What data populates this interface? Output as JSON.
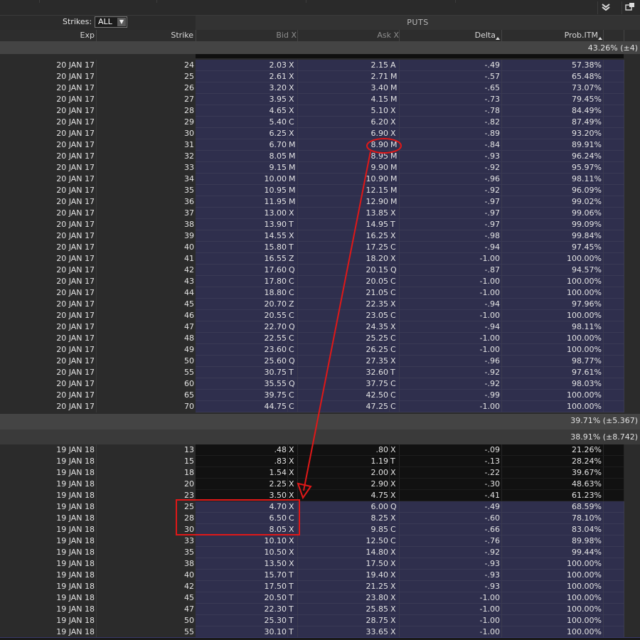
{
  "toolbar": {
    "collapse_icon": "chevron-down-icon",
    "popout_icon": "popout-icon"
  },
  "controls": {
    "strikes_label": "Strikes:",
    "strikes_value": "ALL"
  },
  "header": {
    "section": "PUTS",
    "columns": {
      "exp": "Exp",
      "strike": "Strike",
      "bid": "Bid X",
      "ask": "Ask X",
      "delta": "Delta",
      "prob": "Prob.ITM"
    }
  },
  "bands": {
    "jan17_top": "43.26% (±4)",
    "jan17_bottom": "39.71% (±5.367)",
    "jan18_top": "38.91% (±8.742)"
  },
  "jan17_rows": [
    {
      "exp": "20 JAN 17",
      "strike": "24",
      "bid": "2.03",
      "bx": "X",
      "ask": "2.15",
      "ax": "A",
      "delta": "-.49",
      "prob": "57.38%"
    },
    {
      "exp": "20 JAN 17",
      "strike": "25",
      "bid": "2.61",
      "bx": "X",
      "ask": "2.71",
      "ax": "M",
      "delta": "-.57",
      "prob": "65.48%"
    },
    {
      "exp": "20 JAN 17",
      "strike": "26",
      "bid": "3.20",
      "bx": "X",
      "ask": "3.40",
      "ax": "M",
      "delta": "-.65",
      "prob": "73.07%"
    },
    {
      "exp": "20 JAN 17",
      "strike": "27",
      "bid": "3.95",
      "bx": "X",
      "ask": "4.15",
      "ax": "M",
      "delta": "-.73",
      "prob": "79.45%"
    },
    {
      "exp": "20 JAN 17",
      "strike": "28",
      "bid": "4.65",
      "bx": "X",
      "ask": "5.10",
      "ax": "X",
      "delta": "-.78",
      "prob": "84.49%"
    },
    {
      "exp": "20 JAN 17",
      "strike": "29",
      "bid": "5.40",
      "bx": "C",
      "ask": "6.20",
      "ax": "X",
      "delta": "-.82",
      "prob": "87.49%"
    },
    {
      "exp": "20 JAN 17",
      "strike": "30",
      "bid": "6.25",
      "bx": "X",
      "ask": "6.90",
      "ax": "X",
      "delta": "-.89",
      "prob": "93.20%"
    },
    {
      "exp": "20 JAN 17",
      "strike": "31",
      "bid": "6.70",
      "bx": "M",
      "ask": "8.90",
      "ax": "M",
      "delta": "-.84",
      "prob": "89.91%"
    },
    {
      "exp": "20 JAN 17",
      "strike": "32",
      "bid": "8.05",
      "bx": "M",
      "ask": "8.95",
      "ax": "M",
      "delta": "-.93",
      "prob": "96.24%"
    },
    {
      "exp": "20 JAN 17",
      "strike": "33",
      "bid": "9.15",
      "bx": "M",
      "ask": "9.90",
      "ax": "M",
      "delta": "-.92",
      "prob": "95.97%"
    },
    {
      "exp": "20 JAN 17",
      "strike": "34",
      "bid": "10.00",
      "bx": "M",
      "ask": "10.90",
      "ax": "M",
      "delta": "-.96",
      "prob": "98.11%"
    },
    {
      "exp": "20 JAN 17",
      "strike": "35",
      "bid": "10.95",
      "bx": "M",
      "ask": "12.15",
      "ax": "M",
      "delta": "-.92",
      "prob": "96.09%"
    },
    {
      "exp": "20 JAN 17",
      "strike": "36",
      "bid": "11.95",
      "bx": "M",
      "ask": "12.90",
      "ax": "M",
      "delta": "-.97",
      "prob": "99.02%"
    },
    {
      "exp": "20 JAN 17",
      "strike": "37",
      "bid": "13.00",
      "bx": "X",
      "ask": "13.85",
      "ax": "X",
      "delta": "-.97",
      "prob": "99.06%"
    },
    {
      "exp": "20 JAN 17",
      "strike": "38",
      "bid": "13.90",
      "bx": "T",
      "ask": "14.95",
      "ax": "T",
      "delta": "-.97",
      "prob": "99.09%"
    },
    {
      "exp": "20 JAN 17",
      "strike": "39",
      "bid": "14.55",
      "bx": "X",
      "ask": "16.25",
      "ax": "X",
      "delta": "-.98",
      "prob": "99.84%"
    },
    {
      "exp": "20 JAN 17",
      "strike": "40",
      "bid": "15.80",
      "bx": "T",
      "ask": "17.25",
      "ax": "C",
      "delta": "-.94",
      "prob": "97.45%"
    },
    {
      "exp": "20 JAN 17",
      "strike": "41",
      "bid": "16.55",
      "bx": "Z",
      "ask": "18.20",
      "ax": "X",
      "delta": "-1.00",
      "prob": "100.00%"
    },
    {
      "exp": "20 JAN 17",
      "strike": "42",
      "bid": "17.60",
      "bx": "Q",
      "ask": "20.15",
      "ax": "Q",
      "delta": "-.87",
      "prob": "94.57%"
    },
    {
      "exp": "20 JAN 17",
      "strike": "43",
      "bid": "17.80",
      "bx": "C",
      "ask": "20.05",
      "ax": "C",
      "delta": "-1.00",
      "prob": "100.00%"
    },
    {
      "exp": "20 JAN 17",
      "strike": "44",
      "bid": "18.80",
      "bx": "C",
      "ask": "21.05",
      "ax": "C",
      "delta": "-1.00",
      "prob": "100.00%"
    },
    {
      "exp": "20 JAN 17",
      "strike": "45",
      "bid": "20.70",
      "bx": "Z",
      "ask": "22.35",
      "ax": "X",
      "delta": "-.94",
      "prob": "97.96%"
    },
    {
      "exp": "20 JAN 17",
      "strike": "46",
      "bid": "20.55",
      "bx": "C",
      "ask": "23.05",
      "ax": "C",
      "delta": "-1.00",
      "prob": "100.00%"
    },
    {
      "exp": "20 JAN 17",
      "strike": "47",
      "bid": "22.70",
      "bx": "Q",
      "ask": "24.35",
      "ax": "X",
      "delta": "-.94",
      "prob": "98.11%"
    },
    {
      "exp": "20 JAN 17",
      "strike": "48",
      "bid": "22.55",
      "bx": "C",
      "ask": "25.25",
      "ax": "C",
      "delta": "-1.00",
      "prob": "100.00%"
    },
    {
      "exp": "20 JAN 17",
      "strike": "49",
      "bid": "23.60",
      "bx": "C",
      "ask": "26.25",
      "ax": "C",
      "delta": "-1.00",
      "prob": "100.00%"
    },
    {
      "exp": "20 JAN 17",
      "strike": "50",
      "bid": "25.60",
      "bx": "Q",
      "ask": "27.35",
      "ax": "X",
      "delta": "-.96",
      "prob": "98.77%"
    },
    {
      "exp": "20 JAN 17",
      "strike": "55",
      "bid": "30.75",
      "bx": "T",
      "ask": "32.60",
      "ax": "T",
      "delta": "-.92",
      "prob": "97.61%"
    },
    {
      "exp": "20 JAN 17",
      "strike": "60",
      "bid": "35.55",
      "bx": "Q",
      "ask": "37.75",
      "ax": "C",
      "delta": "-.92",
      "prob": "98.03%"
    },
    {
      "exp": "20 JAN 17",
      "strike": "65",
      "bid": "39.75",
      "bx": "C",
      "ask": "42.50",
      "ax": "C",
      "delta": "-.99",
      "prob": "100.00%"
    },
    {
      "exp": "20 JAN 17",
      "strike": "70",
      "bid": "44.75",
      "bx": "C",
      "ask": "47.25",
      "ax": "C",
      "delta": "-1.00",
      "prob": "100.00%"
    }
  ],
  "jan18_rows": [
    {
      "exp": "19 JAN 18",
      "strike": "13",
      "bid": ".48",
      "bx": "X",
      "ask": ".80",
      "ax": "X",
      "delta": "-.09",
      "prob": "21.26%",
      "itm": false
    },
    {
      "exp": "19 JAN 18",
      "strike": "15",
      "bid": ".83",
      "bx": "X",
      "ask": "1.19",
      "ax": "T",
      "delta": "-.13",
      "prob": "28.24%",
      "itm": false
    },
    {
      "exp": "19 JAN 18",
      "strike": "18",
      "bid": "1.54",
      "bx": "X",
      "ask": "2.00",
      "ax": "X",
      "delta": "-.22",
      "prob": "39.67%",
      "itm": false
    },
    {
      "exp": "19 JAN 18",
      "strike": "20",
      "bid": "2.25",
      "bx": "X",
      "ask": "2.90",
      "ax": "X",
      "delta": "-.30",
      "prob": "48.63%",
      "itm": false
    },
    {
      "exp": "19 JAN 18",
      "strike": "23",
      "bid": "3.50",
      "bx": "X",
      "ask": "4.75",
      "ax": "X",
      "delta": "-.41",
      "prob": "61.23%",
      "itm": false
    },
    {
      "exp": "19 JAN 18",
      "strike": "25",
      "bid": "4.70",
      "bx": "X",
      "ask": "6.00",
      "ax": "Q",
      "delta": "-.49",
      "prob": "68.59%",
      "itm": true
    },
    {
      "exp": "19 JAN 18",
      "strike": "28",
      "bid": "6.50",
      "bx": "C",
      "ask": "8.25",
      "ax": "X",
      "delta": "-.60",
      "prob": "78.10%",
      "itm": true
    },
    {
      "exp": "19 JAN 18",
      "strike": "30",
      "bid": "8.05",
      "bx": "X",
      "ask": "9.85",
      "ax": "C",
      "delta": "-.66",
      "prob": "83.04%",
      "itm": true
    },
    {
      "exp": "19 JAN 18",
      "strike": "33",
      "bid": "10.10",
      "bx": "X",
      "ask": "12.50",
      "ax": "C",
      "delta": "-.76",
      "prob": "89.98%",
      "itm": true
    },
    {
      "exp": "19 JAN 18",
      "strike": "35",
      "bid": "10.50",
      "bx": "X",
      "ask": "14.80",
      "ax": "X",
      "delta": "-.92",
      "prob": "99.44%",
      "itm": true
    },
    {
      "exp": "19 JAN 18",
      "strike": "38",
      "bid": "13.50",
      "bx": "X",
      "ask": "17.50",
      "ax": "X",
      "delta": "-.93",
      "prob": "100.00%",
      "itm": true
    },
    {
      "exp": "19 JAN 18",
      "strike": "40",
      "bid": "15.70",
      "bx": "T",
      "ask": "19.40",
      "ax": "X",
      "delta": "-.93",
      "prob": "100.00%",
      "itm": true
    },
    {
      "exp": "19 JAN 18",
      "strike": "42",
      "bid": "17.50",
      "bx": "T",
      "ask": "21.25",
      "ax": "X",
      "delta": "-.93",
      "prob": "100.00%",
      "itm": true
    },
    {
      "exp": "19 JAN 18",
      "strike": "45",
      "bid": "20.50",
      "bx": "T",
      "ask": "23.80",
      "ax": "X",
      "delta": "-1.00",
      "prob": "100.00%",
      "itm": true
    },
    {
      "exp": "19 JAN 18",
      "strike": "47",
      "bid": "22.30",
      "bx": "T",
      "ask": "25.85",
      "ax": "X",
      "delta": "-1.00",
      "prob": "100.00%",
      "itm": true
    },
    {
      "exp": "19 JAN 18",
      "strike": "50",
      "bid": "25.30",
      "bx": "T",
      "ask": "28.75",
      "ax": "X",
      "delta": "-1.00",
      "prob": "100.00%",
      "itm": true
    },
    {
      "exp": "19 JAN 18",
      "strike": "55",
      "bid": "30.10",
      "bx": "T",
      "ask": "33.65",
      "ax": "X",
      "delta": "-1.00",
      "prob": "100.00%",
      "itm": true
    }
  ],
  "annotations": {
    "color": "#e01818"
  }
}
